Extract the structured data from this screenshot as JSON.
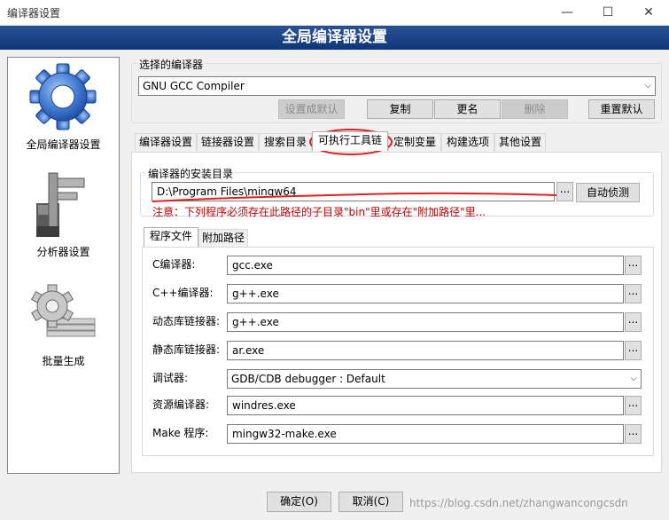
{
  "window": {
    "title": "编译器设置",
    "minimize_glyph": "—",
    "maximize_glyph": "☐",
    "close_glyph": "✕"
  },
  "banner": {
    "title": "全局编译器设置"
  },
  "sidebar": {
    "items": [
      {
        "label": "全局编译器设置",
        "icon": "gear-icon",
        "selected": true
      },
      {
        "label": "分析器设置",
        "icon": "caliper-icon",
        "selected": false
      },
      {
        "label": "批量生成",
        "icon": "batch-gear-icon",
        "selected": false
      }
    ]
  },
  "compiler_select": {
    "legend": "选择的编译器",
    "value": "GNU GCC Compiler",
    "buttons": {
      "set_default": "设置成默认",
      "copy": "复制",
      "rename": "更名",
      "delete": "删除",
      "reset_defaults": "重置默认"
    }
  },
  "tabs": [
    {
      "label": "编译器设置",
      "active": false
    },
    {
      "label": "链接器设置",
      "active": false
    },
    {
      "label": "搜索目录",
      "active": false
    },
    {
      "label": "可执行工具链",
      "active": true
    },
    {
      "label": "定制变量",
      "active": false
    },
    {
      "label": "构建选项",
      "active": false
    },
    {
      "label": "其他设置",
      "active": false
    }
  ],
  "install_dir": {
    "legend": "编译器的安装目录",
    "value": "D:\\Program Files\\mingw64",
    "browse": "...",
    "auto_detect": "自动侦测",
    "note": "注意：下列程序必须存在此路径的子目录\"bin\"里或存在\"附加路径\"里..."
  },
  "subtabs": [
    {
      "label": "程序文件",
      "active": true
    },
    {
      "label": "附加路径",
      "active": false
    }
  ],
  "programs": [
    {
      "label": "C编译器:",
      "value": "gcc.exe",
      "type": "text"
    },
    {
      "label": "C++编译器:",
      "value": "g++.exe",
      "type": "text"
    },
    {
      "label": "动态库链接器:",
      "value": "g++.exe",
      "type": "text"
    },
    {
      "label": "静态库链接器:",
      "value": "ar.exe",
      "type": "text"
    },
    {
      "label": "调试器:",
      "value": "GDB/CDB debugger : Default",
      "type": "combo"
    },
    {
      "label": "资源编译器:",
      "value": "windres.exe",
      "type": "text"
    },
    {
      "label": "Make 程序:",
      "value": "mingw32-make.exe",
      "type": "text"
    }
  ],
  "footer": {
    "ok": "确定(O)",
    "cancel": "取消(C)"
  },
  "watermark": "https://blog.csdn.net/zhangwancongcsdn",
  "colors": {
    "banner": "#1c4386",
    "annotation_red": "#e02020",
    "note_red": "#c00000"
  }
}
